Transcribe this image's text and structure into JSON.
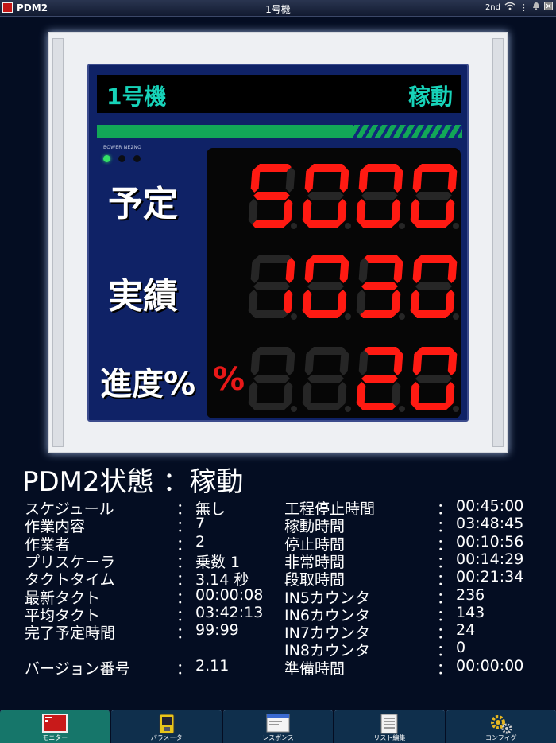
{
  "statusbar": {
    "app_name": "PDM2",
    "title": "1号機",
    "mode": "2nd",
    "icons": [
      "wifi-icon",
      "menu-dots-icon",
      "bell-icon",
      "close-icon"
    ]
  },
  "board": {
    "machine_name": "1号機",
    "machine_status": "稼動",
    "progress_ratio": 0.2,
    "led_label": "BOWER NE2NO",
    "leds": [
      true,
      false,
      false
    ],
    "rows": [
      {
        "label": "予定",
        "value": "5000"
      },
      {
        "label": "実績",
        "value": "1030"
      },
      {
        "label": "進度%",
        "value": "20",
        "unit": "%"
      }
    ],
    "colors": {
      "lit": "#ff1a12",
      "unlit": "#262626",
      "accent": "#17d3b9"
    }
  },
  "state_title": "PDM2状態 ：稼動",
  "info_left": [
    {
      "label": "スケジュール",
      "sep": "：",
      "value": "無し"
    },
    {
      "label": "作業内容",
      "sep": "：",
      "value": "7"
    },
    {
      "label": "作業者",
      "sep": "：",
      "value": "2"
    },
    {
      "label": "プリスケーラ",
      "sep": "：",
      "value": "乗数 1"
    },
    {
      "label": "タクトタイム",
      "sep": "：",
      "value": "3.14 秒"
    },
    {
      "label": "最新タクト",
      "sep": "：",
      "value": "00:00:08"
    },
    {
      "label": "平均タクト",
      "sep": "：",
      "value": "03:42:13"
    },
    {
      "label": "完了予定時間",
      "sep": "：",
      "value": "99:99"
    },
    {
      "label": "バージョン番号",
      "sep": "：",
      "value": "2.11"
    }
  ],
  "info_right": [
    {
      "label": "工程停止時間",
      "sep": "：",
      "value": "00:45:00"
    },
    {
      "label": "稼動時間",
      "sep": "：",
      "value": "03:48:45"
    },
    {
      "label": "停止時間",
      "sep": "：",
      "value": "00:10:56"
    },
    {
      "label": "非常時間",
      "sep": "：",
      "value": "00:14:29"
    },
    {
      "label": "段取時間",
      "sep": "：",
      "value": "00:21:34"
    },
    {
      "label": "IN5カウンタ",
      "sep": "：",
      "value": "236"
    },
    {
      "label": "IN6カウンタ",
      "sep": "：",
      "value": "143"
    },
    {
      "label": "IN7カウンタ",
      "sep": "：",
      "value": "24"
    },
    {
      "label": "IN8カウンタ",
      "sep": "：",
      "value": "0"
    },
    {
      "label": "準備時間",
      "sep": "：",
      "value": "00:00:00"
    }
  ],
  "tabs": [
    {
      "label": "モニター",
      "icon": "monitor-icon",
      "active": true
    },
    {
      "label": "パラメータ",
      "icon": "parameter-icon",
      "active": false
    },
    {
      "label": "レスポンス",
      "icon": "response-icon",
      "active": false
    },
    {
      "label": "リスト編集",
      "icon": "list-edit-icon",
      "active": false
    },
    {
      "label": "コンフィグ",
      "icon": "config-gear-icon",
      "active": false
    }
  ]
}
